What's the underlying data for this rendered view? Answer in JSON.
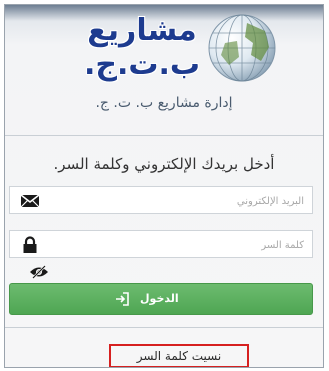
{
  "logo": {
    "line1": "مشاريع",
    "line2": "ب.ت.ج."
  },
  "app_title": "إدارة مشاريع ب. ت. ج.",
  "instruction": "أدخل بريدك الإلكتروني وكلمة السر.",
  "email_field": {
    "placeholder": "البريد الإلكتروني",
    "icon": "envelope-icon"
  },
  "password_field": {
    "placeholder": "كلمة السر",
    "icon": "lock-icon"
  },
  "show_password_icon": "eye-slash-icon",
  "login_button": {
    "label": "الدخول",
    "icon": "sign-in-icon",
    "color": "#5cb85c"
  },
  "forgot_password": {
    "label": "نسيت كلمة السر",
    "highlight_color": "#d62020"
  },
  "colors": {
    "logo": "#1d3b8f",
    "accent_green": "#5cb85c"
  }
}
